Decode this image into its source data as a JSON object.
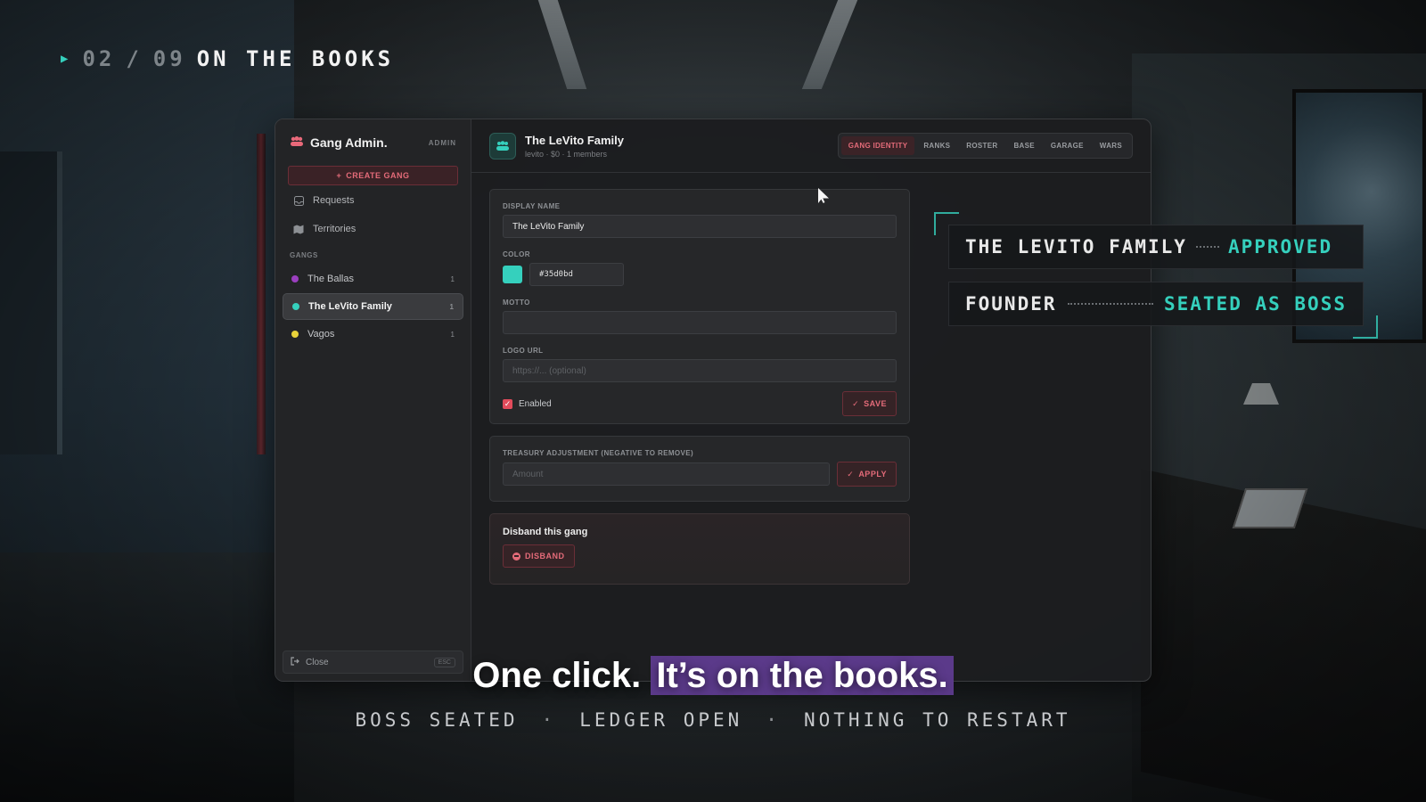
{
  "step": {
    "current": "02",
    "separator": "/",
    "total": "09",
    "title": "ON THE BOOKS"
  },
  "sidebar": {
    "brand": "Gang Admin.",
    "badge": "ADMIN",
    "create_label": "CREATE GANG",
    "nav": [
      {
        "label": "Requests",
        "icon": "inbox-icon"
      },
      {
        "label": "Territories",
        "icon": "map-icon"
      }
    ],
    "section_label": "GANGS",
    "gangs": [
      {
        "name": "The Ballas",
        "count": "1",
        "color": "#9b3fbf"
      },
      {
        "name": "The LeVito Family",
        "count": "1",
        "color": "#35d0bd",
        "active": true
      },
      {
        "name": "Vagos",
        "count": "1",
        "color": "#e8d23a"
      }
    ],
    "close_label": "Close",
    "close_key": "ESC"
  },
  "header": {
    "title": "The LeVito Family",
    "subtitle": "levito · $0 · 1 members",
    "tabs": [
      "GANG IDENTITY",
      "RANKS",
      "ROSTER",
      "BASE",
      "GARAGE",
      "WARS"
    ],
    "active_tab": "GANG IDENTITY"
  },
  "identity": {
    "display_name_label": "DISPLAY NAME",
    "display_name_value": "The LeVito Family",
    "color_label": "COLOR",
    "color_value": "#35d0bd",
    "motto_label": "MOTTO",
    "motto_value": "",
    "logo_label": "LOGO URL",
    "logo_placeholder": "https://... (optional)",
    "enabled_label": "Enabled",
    "enabled": true,
    "save_label": "SAVE"
  },
  "treasury": {
    "label": "TREASURY ADJUSTMENT (NEGATIVE TO REMOVE)",
    "placeholder": "Amount",
    "apply_label": "APPLY"
  },
  "disband": {
    "title": "Disband this gang",
    "button_label": "DISBAND"
  },
  "callouts": [
    {
      "key": "THE LEVITO FAMILY",
      "value": "APPROVED"
    },
    {
      "key": "FOUNDER",
      "value": "SEATED AS BOSS"
    }
  ],
  "caption": {
    "plain": "One click.",
    "highlight": "It’s on the books."
  },
  "subcaption": [
    "BOSS SEATED",
    "LEDGER OPEN",
    "NOTHING TO RESTART"
  ],
  "subcaption_separator": "·",
  "colors": {
    "accent": "#35d0bd",
    "danger": "#e46b79",
    "highlight": "#5b3a8a"
  }
}
